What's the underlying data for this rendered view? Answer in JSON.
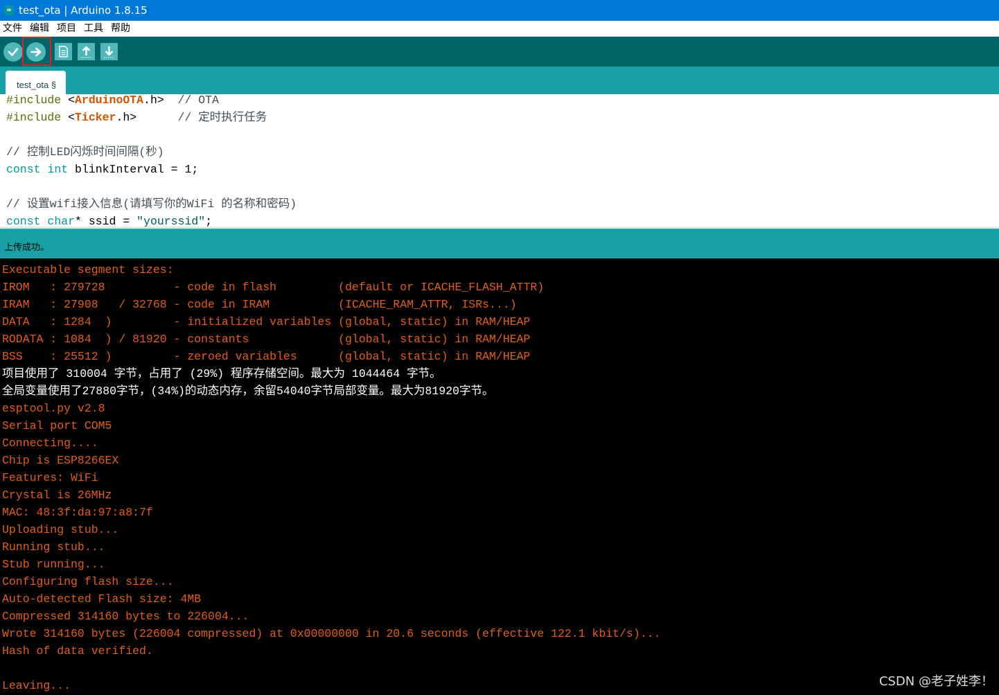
{
  "window": {
    "title": "test_ota | Arduino 1.8.15",
    "icon": "arduino-logo-icon",
    "icon_glyph": "∞"
  },
  "menu": [
    "文件",
    "编辑",
    "项目",
    "工具",
    "帮助"
  ],
  "toolbar": {
    "buttons": [
      {
        "name": "verify-button",
        "icon": "check-icon"
      },
      {
        "name": "upload-button",
        "icon": "arrow-right-icon",
        "highlighted": true
      },
      {
        "name": "new-button",
        "icon": "new-file-icon"
      },
      {
        "name": "open-button",
        "icon": "arrow-up-icon"
      },
      {
        "name": "save-button",
        "icon": "arrow-down-icon"
      }
    ]
  },
  "tab": {
    "label": "test_ota §"
  },
  "editor": {
    "lines": [
      [
        {
          "t": "#include",
          "c": "kw-pre"
        },
        {
          "t": " <"
        },
        {
          "t": "ArduinoOTA",
          "c": "lib"
        },
        {
          "t": ".h>  "
        },
        {
          "t": "// OTA",
          "c": "cmt"
        }
      ],
      [
        {
          "t": "#include",
          "c": "kw-pre"
        },
        {
          "t": " <"
        },
        {
          "t": "Ticker",
          "c": "lib"
        },
        {
          "t": ".h>      "
        },
        {
          "t": "// 定时执行任务",
          "c": "cmt"
        }
      ],
      [],
      [
        {
          "t": "// 控制LED闪烁时间间隔(秒)",
          "c": "cmt"
        }
      ],
      [
        {
          "t": "const",
          "c": "kw"
        },
        {
          "t": " "
        },
        {
          "t": "int",
          "c": "kw"
        },
        {
          "t": " blinkInterval = 1;"
        }
      ],
      [],
      [
        {
          "t": "// 设置wifi接入信息(请填写你的WiFi 的名称和密码)",
          "c": "cmt"
        }
      ],
      [
        {
          "t": "const",
          "c": "kw"
        },
        {
          "t": " "
        },
        {
          "t": "char",
          "c": "kw"
        },
        {
          "t": "* ssid = "
        },
        {
          "t": "\"yourssid\"",
          "c": "str"
        },
        {
          "t": ";"
        }
      ]
    ]
  },
  "status": {
    "message": "上传成功。"
  },
  "console": {
    "lines": [
      {
        "t": "Executable segment sizes:"
      },
      {
        "t": "IROM   : 279728          - code in flash         (default or ICACHE_FLASH_ATTR)"
      },
      {
        "t": "IRAM   : 27908   / 32768 - code in IRAM          (ICACHE_RAM_ATTR, ISRs...)"
      },
      {
        "t": "DATA   : 1284  )         - initialized variables (global, static) in RAM/HEAP"
      },
      {
        "t": "RODATA : 1084  ) / 81920 - constants             (global, static) in RAM/HEAP"
      },
      {
        "t": "BSS    : 25512 )         - zeroed variables      (global, static) in RAM/HEAP"
      },
      {
        "t": "项目使用了 310004 字节，占用了 (29%) 程序存储空间。最大为 1044464 字节。",
        "w": true
      },
      {
        "t": "全局变量使用了27880字节，(34%)的动态内存，余留54040字节局部变量。最大为81920字节。",
        "w": true
      },
      {
        "t": "esptool.py v2.8"
      },
      {
        "t": "Serial port COM5"
      },
      {
        "t": "Connecting...."
      },
      {
        "t": "Chip is ESP8266EX"
      },
      {
        "t": "Features: WiFi"
      },
      {
        "t": "Crystal is 26MHz"
      },
      {
        "t": "MAC: 48:3f:da:97:a8:7f"
      },
      {
        "t": "Uploading stub..."
      },
      {
        "t": "Running stub..."
      },
      {
        "t": "Stub running..."
      },
      {
        "t": "Configuring flash size..."
      },
      {
        "t": "Auto-detected Flash size: 4MB"
      },
      {
        "t": "Compressed 314160 bytes to 226004..."
      },
      {
        "t": "Wrote 314160 bytes (226004 compressed) at 0x00000000 in 20.6 seconds (effective 122.1 kbit/s)..."
      },
      {
        "t": "Hash of data verified."
      },
      {
        "t": ""
      },
      {
        "t": "Leaving..."
      }
    ]
  },
  "watermark": "CSDN @老子姓李！",
  "colors": {
    "titlebar": "#0078d7",
    "toolbar": "#006468",
    "tabstrip": "#17a1a5",
    "button": "#4db7bb",
    "console_text": "#e35d16",
    "highlight": "#e02020"
  }
}
